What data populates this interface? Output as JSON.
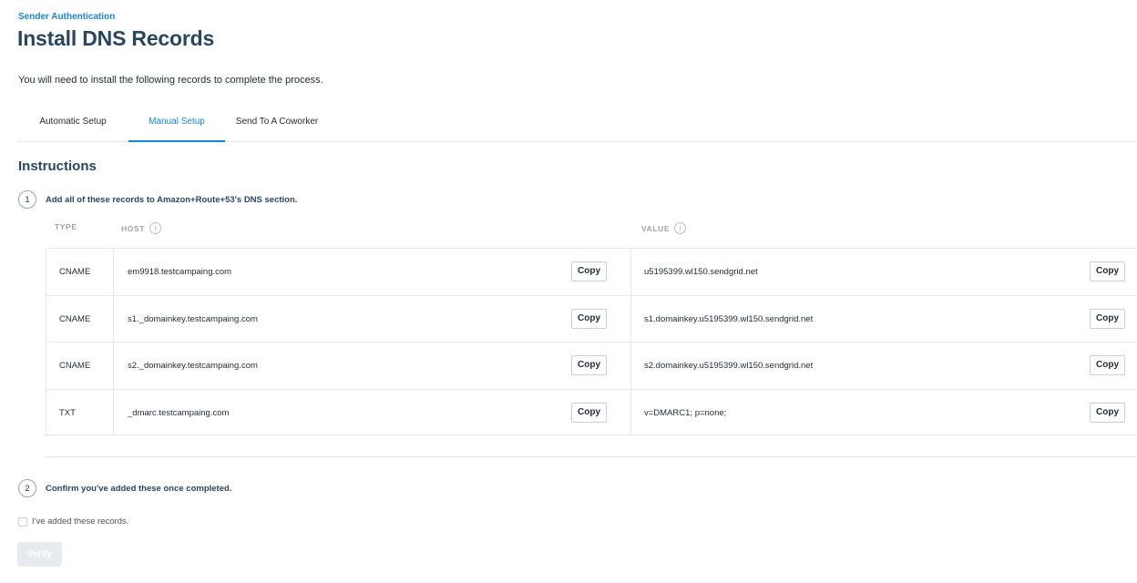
{
  "header": {
    "eyebrow": "Sender Authentication",
    "title": "Install DNS Records",
    "intro": "You will need to install the following records to complete the process."
  },
  "tabs": [
    {
      "label": "Automatic Setup",
      "active": false
    },
    {
      "label": "Manual Setup",
      "active": true
    },
    {
      "label": "Send To A Coworker",
      "active": false
    }
  ],
  "instructions": {
    "title": "Instructions",
    "step1": {
      "number": "1",
      "text": "Add all of these records to Amazon+Route+53's DNS section."
    },
    "step2": {
      "number": "2",
      "text": "Confirm you've added these once completed."
    }
  },
  "table": {
    "headers": {
      "type": "TYPE",
      "host": "HOST",
      "value": "VALUE",
      "info_icon": "i"
    },
    "copy_label": "Copy",
    "rows": [
      {
        "type": "CNAME",
        "host": "em9918.testcampaing.com",
        "value": "u5195399.wl150.sendgrid.net"
      },
      {
        "type": "CNAME",
        "host": "s1._domainkey.testcampaing.com",
        "value": "s1.domainkey.u5195399.wl150.sendgrid.net"
      },
      {
        "type": "CNAME",
        "host": "s2._domainkey.testcampaing.com",
        "value": "s2.domainkey.u5195399.wl150.sendgrid.net"
      },
      {
        "type": "TXT",
        "host": "_dmarc.testcampaing.com",
        "value": "v=DMARC1; p=none;"
      }
    ]
  },
  "confirm": {
    "checkbox_label": "I've added these records.",
    "checked": false
  },
  "verify_button": {
    "label": "Verify",
    "enabled": false
  },
  "colors": {
    "accent": "#1a82e2",
    "heading": "#294661",
    "border": "#e3e8ee"
  }
}
